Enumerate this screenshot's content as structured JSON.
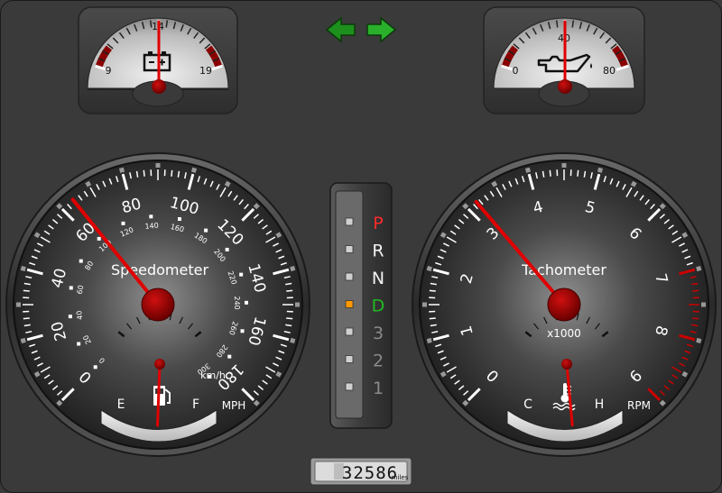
{
  "colors": {
    "panel_bg": "#3a3a3a",
    "needle": "#e00000",
    "arrow_green": "#22aa22",
    "gear_park": "#ff2a2a",
    "gear_drive": "#22b822",
    "gear_active_indicator": "#ff9a00"
  },
  "turn_signals": {
    "left_icon": "arrow-left-green",
    "right_icon": "arrow-right-green"
  },
  "battery_gauge": {
    "icon": "battery-icon",
    "min_label": "9",
    "mid_label": "14",
    "max_label": "19",
    "value": 14
  },
  "oil_gauge": {
    "icon": "oil-can-icon",
    "min_label": "0",
    "mid_label": "40",
    "max_label": "80",
    "value": 40
  },
  "speedometer": {
    "title": "Speedometer",
    "mph_labels": [
      "0",
      "20",
      "40",
      "60",
      "80",
      "100",
      "120",
      "140",
      "160",
      "180"
    ],
    "kmh_labels": [
      "0",
      "20",
      "40",
      "60",
      "80",
      "100",
      "120",
      "140",
      "160",
      "180",
      "200",
      "220",
      "240",
      "260",
      "280",
      "300"
    ],
    "kmh_unit": "km/h",
    "mph_unit": "MPH",
    "value_mph": 64
  },
  "fuel_gauge": {
    "empty_label": "E",
    "full_label": "F",
    "icon": "fuel-pump-icon",
    "value": 0.48
  },
  "gear_selector": {
    "gears": [
      "P",
      "R",
      "N",
      "D",
      "3",
      "2",
      "1"
    ],
    "active": "D"
  },
  "tachometer": {
    "title": "Tachometer",
    "labels": [
      "0",
      "1",
      "2",
      "3",
      "4",
      "5",
      "6",
      "7",
      "8",
      "9"
    ],
    "multiplier": "x1000",
    "unit": "RPM",
    "value_krpm": 3.15
  },
  "temp_gauge": {
    "cold_label": "C",
    "hot_label": "H",
    "icon": "coolant-temperature-icon",
    "value": 0.55
  },
  "odometer": {
    "digits": "32586",
    "unit": "miles"
  }
}
